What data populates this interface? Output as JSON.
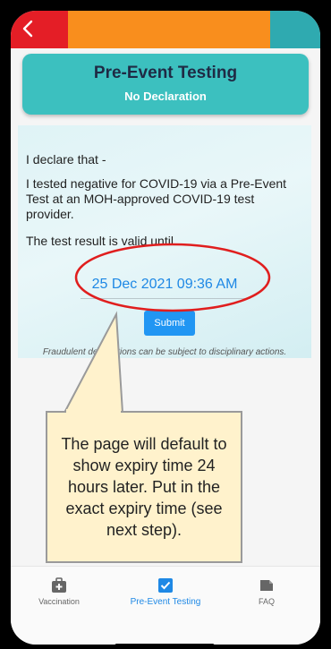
{
  "header": {
    "title": "Pre-Event Testing",
    "subtitle": "No Declaration"
  },
  "declaration": {
    "line1": "I declare that -",
    "line2": "I tested negative for COVID-19 via a Pre-Event Test at an MOH-approved COVID-19 test provider.",
    "line3": "The test result is valid until",
    "expiry_datetime": "25 Dec 2021 09:36 AM",
    "submit_label": "Submit",
    "fraud_warning": "Fraudulent declarations can be subject to disciplinary actions."
  },
  "annotation": {
    "callout_text": "The page will default to show expiry time 24 hours later. Put in the exact expiry time (see next step).",
    "highlight_color": "#e01e1e",
    "callout_fill": "#fff2cc"
  },
  "bottom_nav": {
    "items": [
      {
        "label": "Vaccination",
        "icon": "medical-bag-icon",
        "active": false
      },
      {
        "label": "Pre-Event Testing",
        "icon": "checkbox-icon",
        "active": true
      },
      {
        "label": "FAQ",
        "icon": "document-icon",
        "active": false
      }
    ]
  },
  "colors": {
    "top_red": "#e41e26",
    "top_orange": "#f98e1d",
    "top_teal": "#2faab0",
    "header_bg": "#3cc0bf",
    "accent_blue": "#1e88e5"
  }
}
